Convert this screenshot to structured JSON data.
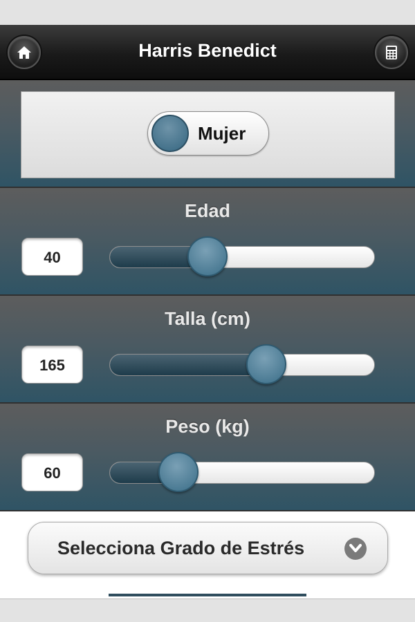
{
  "header": {
    "title": "Harris Benedict",
    "home_icon": "home-icon",
    "calculator_icon": "calculator-icon"
  },
  "gender": {
    "label": "Mujer",
    "knob_color": "#4f7d96"
  },
  "sliders": [
    {
      "id": "edad",
      "label": "Edad",
      "value": "40",
      "fraction": 0.37
    },
    {
      "id": "talla",
      "label": "Talla (cm)",
      "value": "165",
      "fraction": 0.59
    },
    {
      "id": "peso",
      "label": "Peso (kg)",
      "value": "60",
      "fraction": 0.26
    }
  ],
  "stress_select": {
    "label": "Selecciona Grado de Estrés",
    "icon": "chevron-down-icon"
  },
  "colors": {
    "header_bg": "#1a1a1a",
    "panel_accent": "#2f5465",
    "thumb": "#4a7a93"
  }
}
